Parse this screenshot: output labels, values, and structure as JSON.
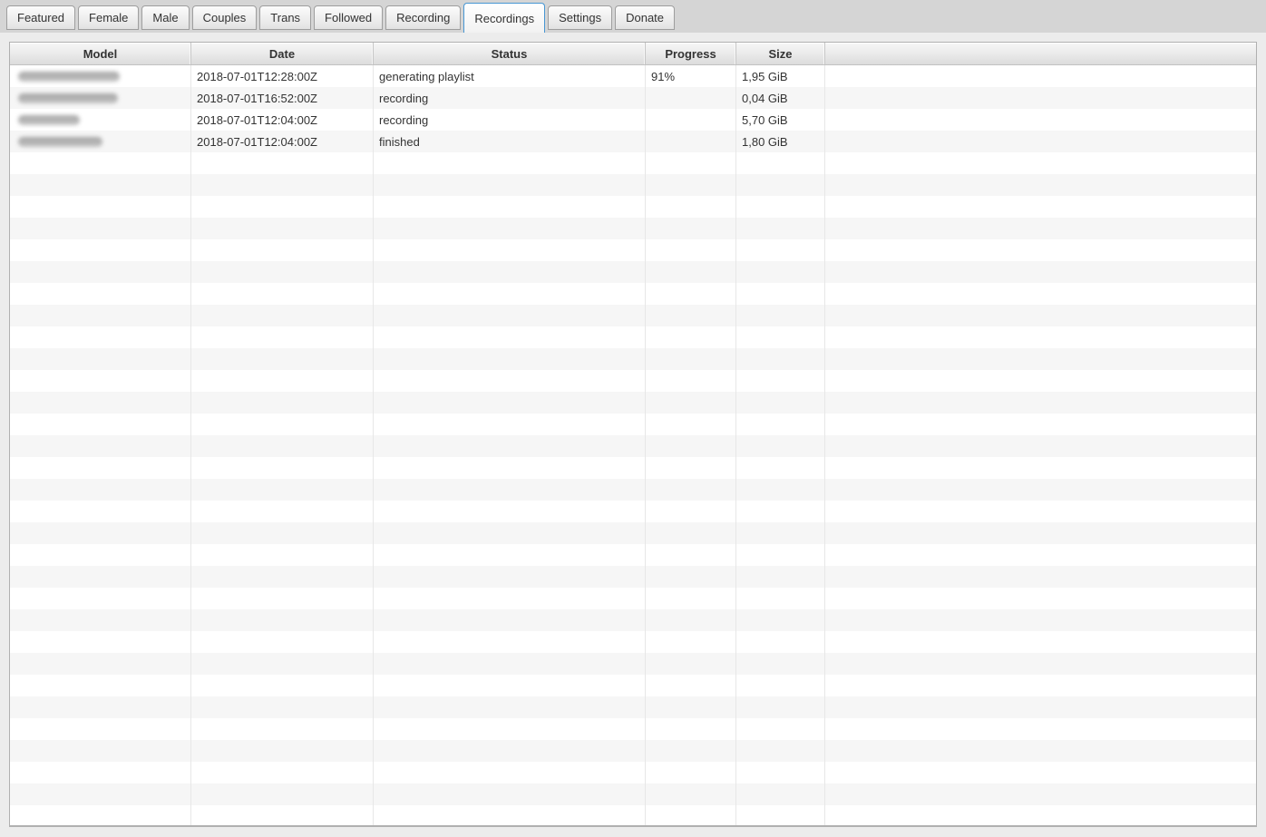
{
  "tabs": {
    "items": [
      {
        "label": "Featured",
        "active": false
      },
      {
        "label": "Female",
        "active": false
      },
      {
        "label": "Male",
        "active": false
      },
      {
        "label": "Couples",
        "active": false
      },
      {
        "label": "Trans",
        "active": false
      },
      {
        "label": "Followed",
        "active": false
      },
      {
        "label": "Recording",
        "active": false
      },
      {
        "label": "Recordings",
        "active": true
      },
      {
        "label": "Settings",
        "active": false
      },
      {
        "label": "Donate",
        "active": false
      }
    ]
  },
  "table": {
    "columns": [
      {
        "label": "Model"
      },
      {
        "label": "Date"
      },
      {
        "label": "Status"
      },
      {
        "label": "Progress"
      },
      {
        "label": "Size"
      },
      {
        "label": ""
      }
    ],
    "rows": [
      {
        "model_redacted": true,
        "redacted_width": 112,
        "date": "2018-07-01T12:28:00Z",
        "status": "generating playlist",
        "progress": "91%",
        "size": "1,95 GiB"
      },
      {
        "model_redacted": true,
        "redacted_width": 110,
        "date": "2018-07-01T16:52:00Z",
        "status": "recording",
        "progress": "",
        "size": "0,04 GiB"
      },
      {
        "model_redacted": true,
        "redacted_width": 68,
        "date": "2018-07-01T12:04:00Z",
        "status": "recording",
        "progress": "",
        "size": "5,70 GiB"
      },
      {
        "model_redacted": true,
        "redacted_width": 93,
        "date": "2018-07-01T12:04:00Z",
        "status": "finished",
        "progress": "",
        "size": "1,80 GiB"
      }
    ],
    "empty_row_count": 31
  },
  "colors": {
    "accent_tab_border": "#4796d3",
    "row_stripe": "#f6f6f6",
    "text": "#333333"
  }
}
